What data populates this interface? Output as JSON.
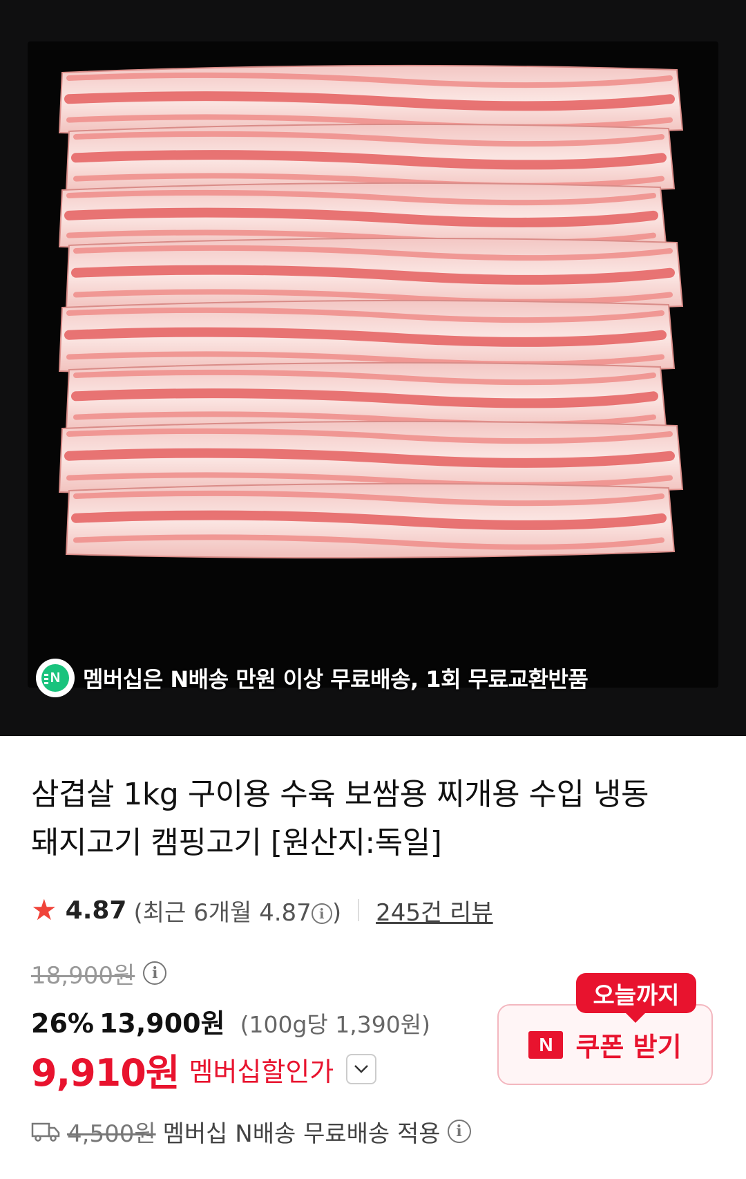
{
  "banner": {
    "icon": "n-delivery-icon",
    "text": "멤버십은 N배송 만원 이상 무료배송, 1회 무료교환반품"
  },
  "product": {
    "title_line1": "삼겹살 1kg 구이용 수육 보쌈용 찌개용 수입 냉동",
    "title_line2": "돼지고기 캠핑고기 [원산지:독일]"
  },
  "rating": {
    "score": "4.87",
    "recent_prefix": "(최근 6개월 4.87",
    "recent_suffix": ")",
    "reviews": "245건 리뷰"
  },
  "price": {
    "original": "18,900원",
    "discount_pct": "26%",
    "sale": "13,900원",
    "unit_price": "(100g당 1,390원)",
    "member_price": "9,910원",
    "member_label": "멤버십할인가"
  },
  "coupon": {
    "tag": "오늘까지",
    "logo": "N",
    "label": "쿠폰 받기"
  },
  "shipping": {
    "fee": "4,500원",
    "text": "멤버십 N배송 무료배송 적용"
  },
  "colors": {
    "accent_red": "#e8132e",
    "star": "#f0443a",
    "n_green": "#19c37d"
  }
}
